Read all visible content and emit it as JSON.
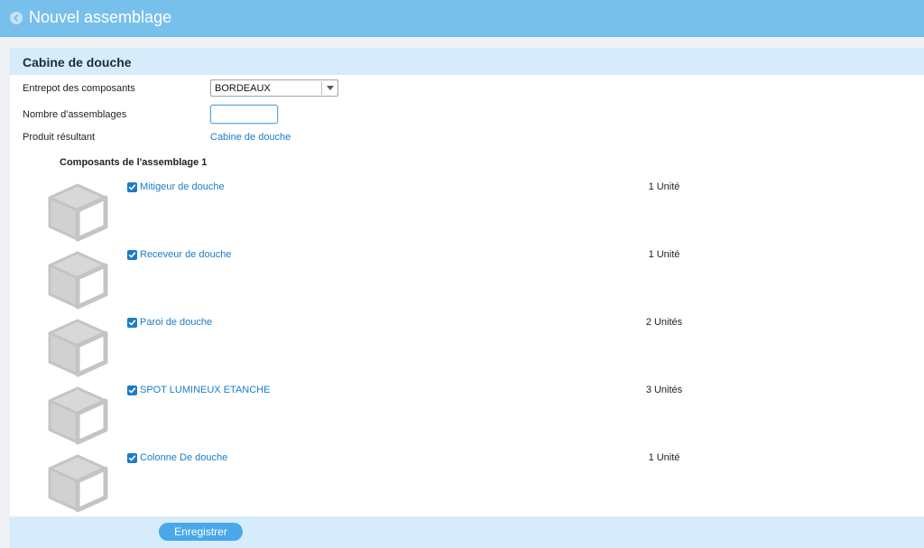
{
  "header": {
    "title": "Nouvel assemblage",
    "back_icon": "chevron-left-circle-icon",
    "bg_color": "#78c0ec"
  },
  "panel": {
    "title": "Cabine de douche"
  },
  "form": {
    "warehouse_label": "Entrepot des composants",
    "warehouse_value": "BORDEAUX",
    "count_label": "Nombre d'assemblages",
    "count_value": "",
    "result_label": "Produit résultant",
    "result_value": "Cabine de douche"
  },
  "components": {
    "heading": "Composants de l'assemblage 1",
    "items": [
      {
        "name": "Mitigeur de douche",
        "qty": "1 Unité",
        "checked": true,
        "icon": "box-icon"
      },
      {
        "name": "Receveur de douche",
        "qty": "1 Unité",
        "checked": true,
        "icon": "box-icon"
      },
      {
        "name": "Paroi de douche",
        "qty": "2 Unités",
        "checked": true,
        "icon": "box-icon"
      },
      {
        "name": "SPOT LUMINEUX ETANCHE",
        "qty": "3 Unités",
        "checked": true,
        "icon": "box-icon"
      },
      {
        "name": "Colonne De douche",
        "qty": "1 Unité",
        "checked": true,
        "icon": "box-icon"
      }
    ]
  },
  "footer": {
    "save_label": "Enregistrer"
  },
  "colors": {
    "accent": "#1a7cc8",
    "button": "#4aa8ea",
    "header_light": "#d6ecfa"
  }
}
